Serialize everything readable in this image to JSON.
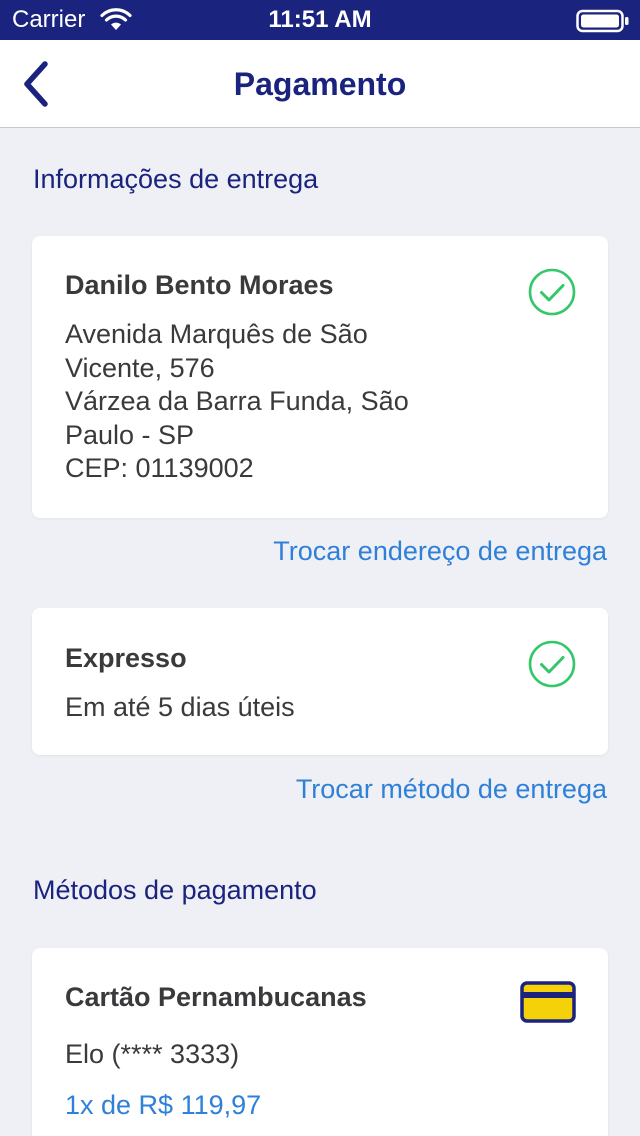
{
  "status_bar": {
    "carrier": "Carrier",
    "time": "11:51 AM",
    "wifi_icon": "wifi-icon",
    "battery_icon": "battery-full-icon"
  },
  "nav": {
    "title": "Pagamento",
    "back_icon": "chevron-left-icon"
  },
  "delivery_section": {
    "title": "Informações de entrega",
    "address_card": {
      "name": "Danilo Bento Moraes",
      "lines": [
        "Avenida Marquês de São",
        "Vicente, 576",
        "Várzea da Barra Funda, São",
        "Paulo - SP",
        "CEP: 01139002"
      ],
      "selected_icon": "check-circle-icon"
    },
    "change_address_link": "Trocar endereço de entrega",
    "shipping_card": {
      "method": "Expresso",
      "eta": "Em até 5 dias úteis",
      "selected_icon": "check-circle-icon"
    },
    "change_shipping_link": "Trocar método de entrega"
  },
  "payment_section": {
    "title": "Métodos de pagamento",
    "card": {
      "name": "Cartão Pernambucanas",
      "brand": "Elo (**** 3333)",
      "installments": "1x de R$ 119,97",
      "icon": "credit-card-icon"
    }
  },
  "colors": {
    "primary": "#1a237e",
    "link": "#2f80d8",
    "success": "#34c76a",
    "card_yellow": "#f5d10a",
    "background": "#eff0f5"
  }
}
